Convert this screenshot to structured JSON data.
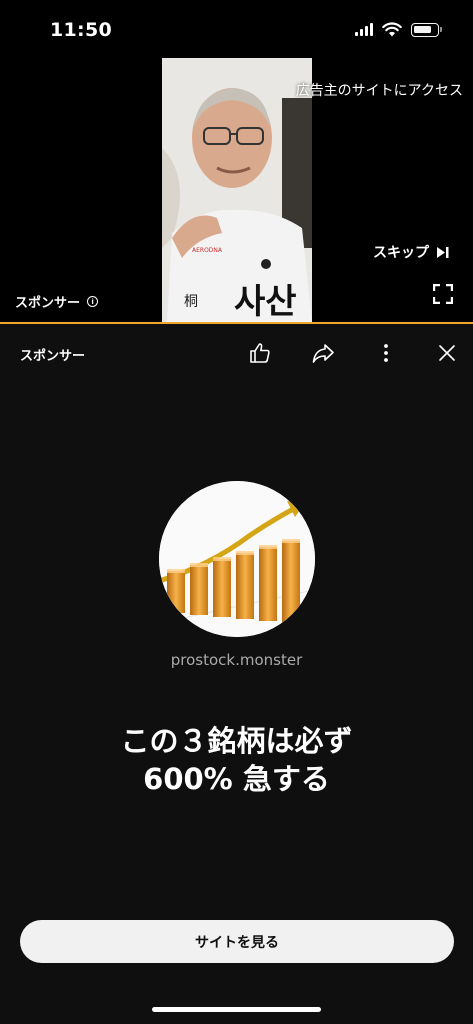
{
  "status_bar": {
    "time": "11:50",
    "battery_level": 0.8
  },
  "video": {
    "advertiser_link": "広告主のサイトにアクセス",
    "skip_label": "スキップ",
    "sponsor_label": "スポンサー"
  },
  "action_bar": {
    "sponsor_label": "スポンサー"
  },
  "ad": {
    "domain": "prostock.monster",
    "headline_line1": "この３銘柄は必ず",
    "headline_line2": "600% 急する",
    "cta_label": "サイトを見る"
  },
  "colors": {
    "accent": "#f0a52c",
    "background": "#0f0f0f",
    "cta_bg": "#f1f1f1"
  }
}
